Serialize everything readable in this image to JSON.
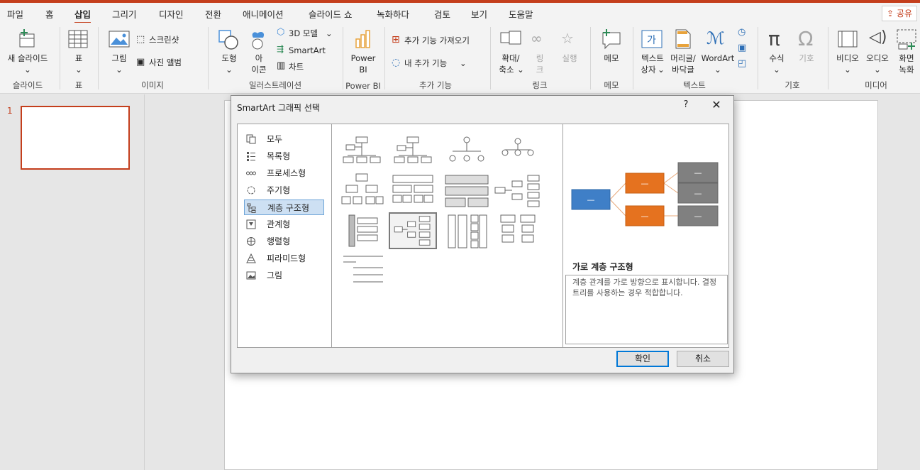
{
  "menu": {
    "tabs": [
      "파일",
      "홈",
      "삽입",
      "그리기",
      "디자인",
      "전환",
      "애니메이션",
      "슬라이드 쇼",
      "녹화하다",
      "검토",
      "보기",
      "도움말"
    ],
    "active_tab": "삽입",
    "share": "공유"
  },
  "ribbon": {
    "slides": {
      "new_slide": "새 슬라이드",
      "label": "슬라이드"
    },
    "table": {
      "table": "표",
      "label": "표"
    },
    "images": {
      "picture": "그림",
      "screenshot": "스크린샷",
      "photo_album": "사진 앨범",
      "label": "이미지"
    },
    "illustrations": {
      "shapes": "도형",
      "icons_1": "아",
      "icons_2": "이콘",
      "model_3d": "3D 모델",
      "smartart": "SmartArt",
      "chart": "차트",
      "label": "일러스트레이션"
    },
    "powerbi": {
      "button_1": "Power",
      "button_2": "BI",
      "label": "Power BI"
    },
    "addins": {
      "get_addins": "추가 기능 가져오기",
      "my_addins": "내 추가 기능",
      "label": "추가 기능"
    },
    "links": {
      "zoom_1": "확대/",
      "zoom_2": "축소",
      "link_1": "링",
      "link_2": "크",
      "action": "실행",
      "label": "링크"
    },
    "comments": {
      "comment": "메모",
      "label": "메모"
    },
    "text": {
      "textbox_1": "텍스트",
      "textbox_2": "상자",
      "header_1": "머리글/",
      "header_2": "바닥글",
      "wordart": "WordArt",
      "label": "텍스트"
    },
    "symbols": {
      "equation": "수식",
      "symbol": "기호",
      "label": "기호"
    },
    "media": {
      "video": "비디오",
      "audio": "오디오",
      "record_1": "화면",
      "record_2": "녹화",
      "label": "미디어"
    }
  },
  "slides_pane": {
    "slide_number": "1"
  },
  "dialog": {
    "title": "SmartArt 그래픽 선택",
    "help": "?",
    "close": "✕",
    "categories": [
      "모두",
      "목록형",
      "프로세스형",
      "주기형",
      "계층 구조형",
      "관계형",
      "행렬형",
      "피라미드형",
      "그림"
    ],
    "selected_category": "계층 구조형",
    "selected_layout_index": 9,
    "layout_count": 13,
    "preview": {
      "title": "가로 계층 구조형",
      "description": "계층 관계를 가로 방향으로 표시합니다. 결정 트리를 사용하는 경우 적합합니다.",
      "box_text": "—",
      "colors": {
        "root": "#3f7fc7",
        "level2": "#e5721f",
        "level3": "#808080",
        "connector": "#e8a97a"
      }
    },
    "ok": "확인",
    "cancel": "취소"
  }
}
